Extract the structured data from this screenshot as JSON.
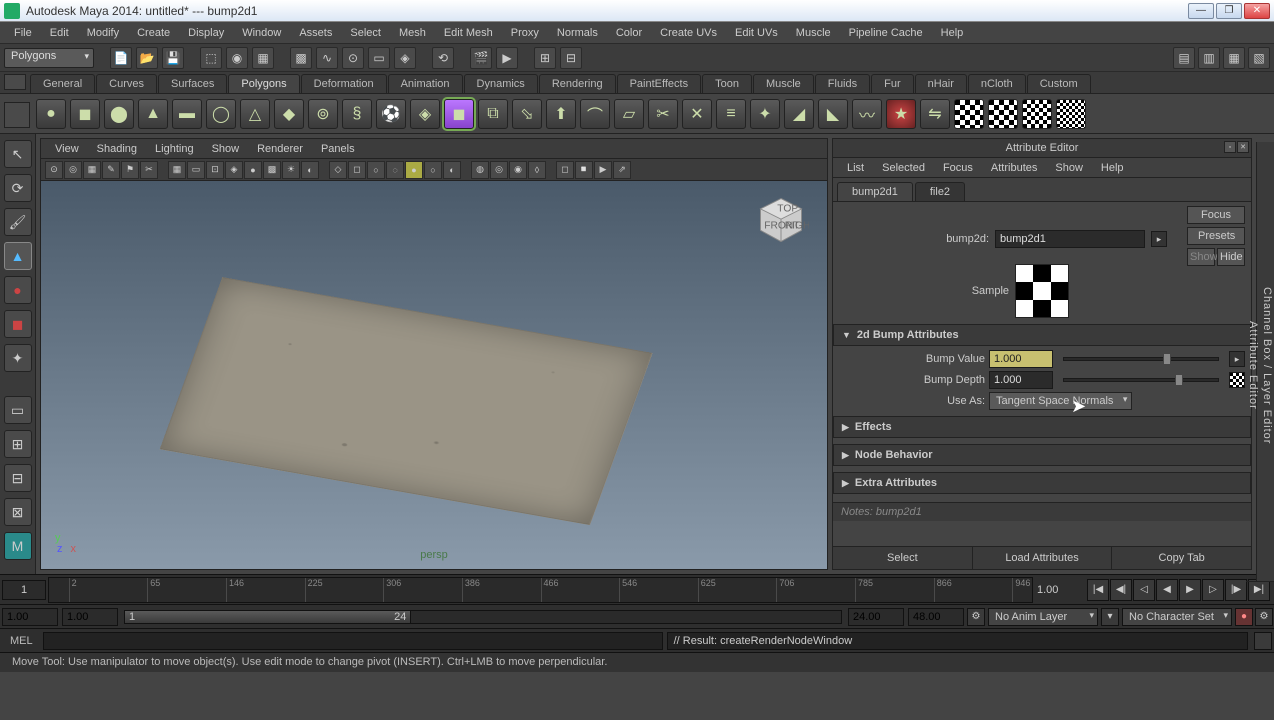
{
  "window": {
    "title": "Autodesk Maya 2014: untitled*   ---   bump2d1"
  },
  "menubar": [
    "File",
    "Edit",
    "Modify",
    "Create",
    "Display",
    "Window",
    "Assets",
    "Select",
    "Mesh",
    "Edit Mesh",
    "Proxy",
    "Normals",
    "Color",
    "Create UVs",
    "Edit UVs",
    "Muscle",
    "Pipeline Cache",
    "Help"
  ],
  "modeCombo": "Polygons",
  "shelfTabs": [
    "General",
    "Curves",
    "Surfaces",
    "Polygons",
    "Deformation",
    "Animation",
    "Dynamics",
    "Rendering",
    "PaintEffects",
    "Toon",
    "Muscle",
    "Fluids",
    "Fur",
    "nHair",
    "nCloth",
    "Custom"
  ],
  "activeShelf": "Polygons",
  "viewportMenu": [
    "View",
    "Shading",
    "Lighting",
    "Show",
    "Renderer",
    "Panels"
  ],
  "perspLabel": "persp",
  "attrEditor": {
    "title": "Attribute Editor",
    "menu": [
      "List",
      "Selected",
      "Focus",
      "Attributes",
      "Show",
      "Help"
    ],
    "tabs": [
      "bump2d1",
      "file2"
    ],
    "activeTab": "bump2d1",
    "nodeTypeLabel": "bump2d:",
    "nodeName": "bump2d1",
    "buttons": {
      "focus": "Focus",
      "presets": "Presets",
      "show": "Show",
      "hide": "Hide"
    },
    "sampleLabel": "Sample",
    "section1": "2d Bump Attributes",
    "bumpValueLabel": "Bump Value",
    "bumpValue": "1.000",
    "bumpDepthLabel": "Bump Depth",
    "bumpDepth": "1.000",
    "useAsLabel": "Use As:",
    "useAs": "Tangent Space Normals",
    "sections": [
      "Effects",
      "Node Behavior",
      "Extra Attributes"
    ],
    "notesLabel": "Notes: bump2d1",
    "footer": [
      "Select",
      "Load Attributes",
      "Copy Tab"
    ]
  },
  "sidebarTabs": [
    "Channel Box / Layer Editor",
    "Attribute Editor"
  ],
  "timeline": {
    "start": "1",
    "end": "1.00",
    "ticks": [
      "2",
      "65",
      "146",
      "225",
      "306",
      "386",
      "466",
      "546",
      "625",
      "706",
      "785",
      "866",
      "946"
    ]
  },
  "range": {
    "startOuter": "1.00",
    "startInner": "1.00",
    "sliderStart": "1",
    "sliderEnd": "24",
    "endInner": "24.00",
    "endOuter": "48.00",
    "animLayer": "No Anim Layer",
    "charSet": "No Character Set"
  },
  "cmd": {
    "label": "MEL",
    "result": "// Result: createRenderNodeWindow"
  },
  "helpLine": "Move Tool: Use manipulator to move object(s). Use edit mode to change pivot (INSERT). Ctrl+LMB to move perpendicular."
}
